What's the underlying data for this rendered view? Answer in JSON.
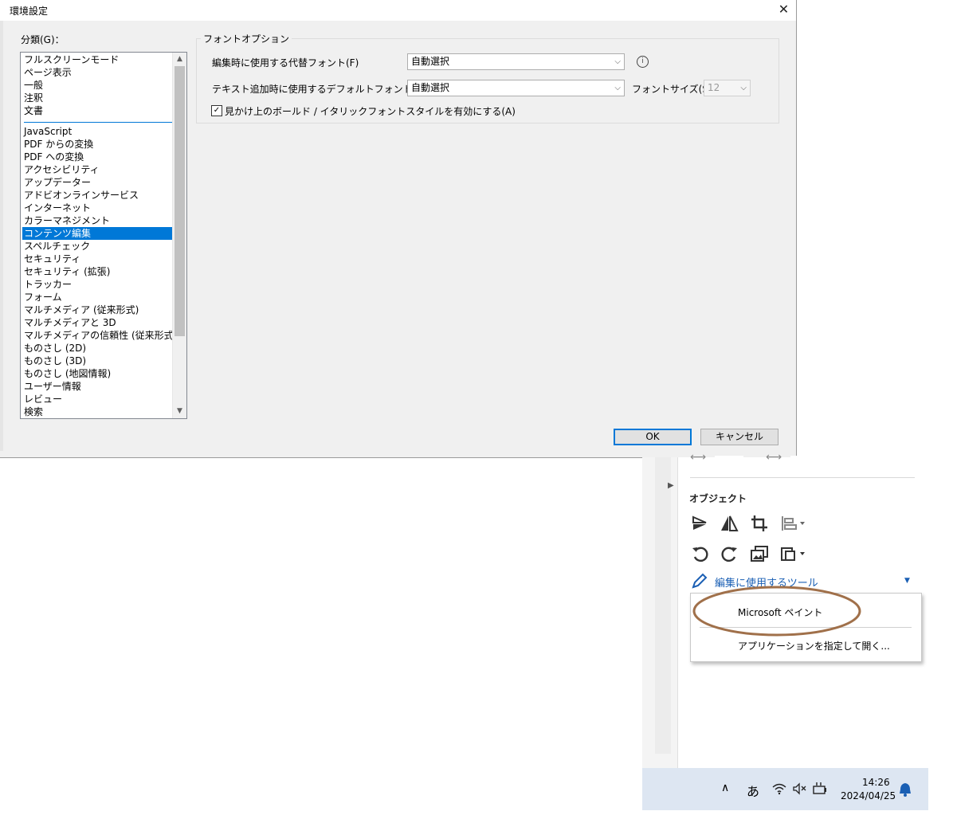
{
  "dialog": {
    "title": "環境設定",
    "close_glyph": "✕",
    "category_label": "分類(G)：",
    "categories_top": [
      "フルスクリーンモード",
      "ページ表示",
      "一般",
      "注釈",
      "文書"
    ],
    "categories_bottom": [
      "JavaScript",
      "PDF からの変換",
      "PDF への変換",
      "アクセシビリティ",
      "アップデーター",
      "アドビオンラインサービス",
      "インターネット",
      "カラーマネジメント",
      "コンテンツ編集",
      "スペルチェック",
      "セキュリティ",
      "セキュリティ (拡張)",
      "トラッカー",
      "フォーム",
      "マルチメディア (従来形式)",
      "マルチメディアと 3D",
      "マルチメディアの信頼性 (従来形式)",
      "ものさし (2D)",
      "ものさし (3D)",
      "ものさし (地図情報)",
      "ユーザー情報",
      "レビュー",
      "検索"
    ],
    "selected_category": "コンテンツ編集",
    "font_options": {
      "group_title": "フォントオプション",
      "fallback_font_label": "編集時に使用する代替フォント(F)",
      "fallback_font_value": "自動選択",
      "default_font_label": "テキスト追加時に使用するデフォルトフォント(A)",
      "default_font_value": "自動選択",
      "font_size_label": "フォントサイズ(S)",
      "font_size_value": "12",
      "fake_bold_italic_label": "見かけ上のボールド / イタリックフォントスタイルを有効にする(A)",
      "fake_bold_italic_checked": true
    },
    "ok_label": "OK",
    "cancel_label": "キャンセル"
  },
  "panel": {
    "object_heading": "オブジェクト",
    "edit_tools_label": "編集に使用するツール",
    "menu_items": [
      "Microsoft ペイント",
      "アプリケーションを指定して開く..."
    ]
  },
  "taskbar": {
    "ime": "あ",
    "time": "14:26",
    "date": "2024/04/25"
  },
  "colors": {
    "selection": "#0078d7",
    "annotation_ellipse": "#a0704a",
    "taskbar": "#dde6f2"
  }
}
